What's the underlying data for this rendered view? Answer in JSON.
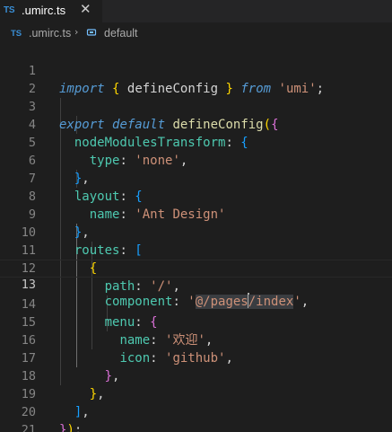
{
  "tab": {
    "icon_text": "TS",
    "filename": ".umirc.ts",
    "close_glyph": "✕"
  },
  "breadcrumb": {
    "icon_text": "TS",
    "file": ".umirc.ts",
    "separator": "›",
    "symbol": "default"
  },
  "editor": {
    "line_numbers": [
      "1",
      "2",
      "3",
      "4",
      "5",
      "6",
      "7",
      "8",
      "9",
      "10",
      "11",
      "12",
      "13",
      "14",
      "15",
      "16",
      "17",
      "18",
      "19",
      "20",
      "21"
    ],
    "current_line": 13,
    "tokens": {
      "import": "import",
      "from": "from",
      "defineConfig": "defineConfig",
      "umi": "'umi'",
      "export": "export",
      "default": "default",
      "nodeModulesTransform": "nodeModulesTransform",
      "type": "type",
      "none": "'none'",
      "layout": "layout",
      "name": "name",
      "antDesign": "'Ant Design'",
      "routes": "routes",
      "path": "path",
      "slash": "'/'",
      "component": "component",
      "compOpen": "'",
      "compAt": "@/pages",
      "compRest": "/index",
      "compClose": "'",
      "menu": "menu",
      "huanying": "'欢迎'",
      "icon": "icon",
      "github": "'github'"
    }
  }
}
